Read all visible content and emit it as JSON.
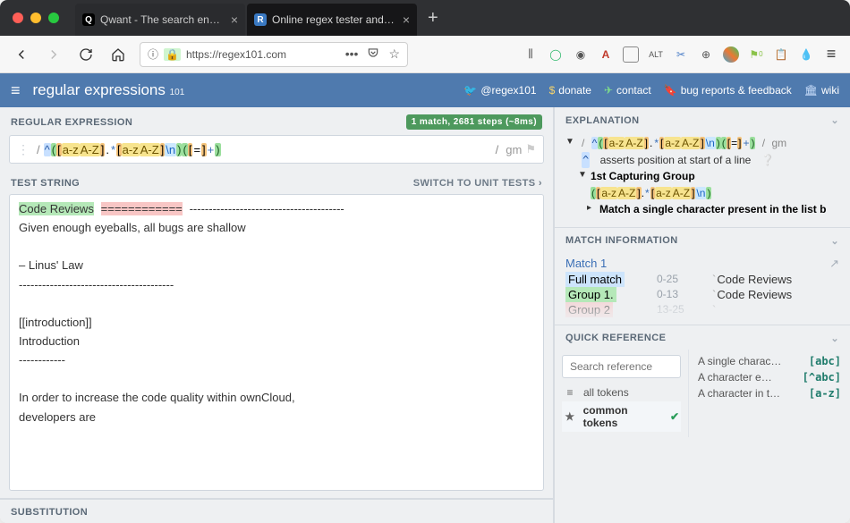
{
  "tabs": [
    {
      "favicon_color": "#22b2a5",
      "favicon_letter": "Q",
      "title": "Qwant - The search engine tha"
    },
    {
      "favicon_color": "#3a79c2",
      "favicon_letter": "R",
      "title": "Online regex tester and debugg"
    }
  ],
  "url": "https://regex101.com",
  "brand": {
    "a": "regular",
    "b": "expressions",
    "sub": "101"
  },
  "top_links": {
    "twitter": "@regex101",
    "donate": "donate",
    "contact": "contact",
    "bugs": "bug reports & feedback",
    "wiki": "wiki"
  },
  "left": {
    "regex_label": "REGULAR EXPRESSION",
    "status_badge": "1 match, 2681 steps (~8ms)",
    "delim_open": "/ ",
    "regex_parts": {
      "anchor": "^",
      "gopen": "(",
      "copen": "[",
      "r1": "a-z",
      "r2": "A-Z",
      "cclose": "]",
      "dot": ".",
      "star": "*",
      "esc": "\\n",
      "gclose": ")",
      "copen2": "[",
      "eq": "=",
      "cclose2": "]",
      "plus": "+"
    },
    "delim_close": " /",
    "flags": "gm",
    "teststring_label": "TEST STRING",
    "teststring_action": "SWITCH TO UNIT TESTS ›",
    "test_hl_title": "Code Reviews",
    "test_hl_underline": "============",
    "test_rest": "----------------------------------------\nGiven enough eyeballs, all bugs are shallow\n\n– Linus' Law\n----------------------------------------\n\n[[introduction]]\nIntroduction\n------------\n\nIn order to increase the code quality within ownCloud,\ndevelopers are",
    "substitution_label": "SUBSTITUTION"
  },
  "right": {
    "explanation_label": "EXPLANATION",
    "exp": {
      "line1_pre": "/ ",
      "line1_flags": "gm",
      "line2": "asserts position at start of a line",
      "line3": "1st Capturing Group",
      "line5": "Match a single character present in the list b"
    },
    "matchinfo_label": "MATCH INFORMATION",
    "match_title": "Match 1",
    "matches": [
      {
        "label": "Full match",
        "cls": "hl-match",
        "range": "0-25",
        "val": "Code Reviews"
      },
      {
        "label": "Group 1.",
        "cls": "hl-g1",
        "range": "0-13",
        "val": "Code Reviews"
      },
      {
        "label": "Group 2",
        "cls": "hl-g2",
        "range": "13-25",
        "val": ""
      }
    ],
    "quickref_label": "QUICK REFERENCE",
    "search_placeholder": "Search reference",
    "qr_left": [
      {
        "icon": "≡",
        "label": "all tokens",
        "sel": false
      },
      {
        "icon": "★",
        "label": "common tokens",
        "sel": true
      }
    ],
    "qr_right": [
      {
        "desc": "A single charac…",
        "sym": "[abc]"
      },
      {
        "desc": "A character e…",
        "sym": "[^abc]"
      },
      {
        "desc": "A character in t…",
        "sym": "[a-z]"
      }
    ]
  }
}
